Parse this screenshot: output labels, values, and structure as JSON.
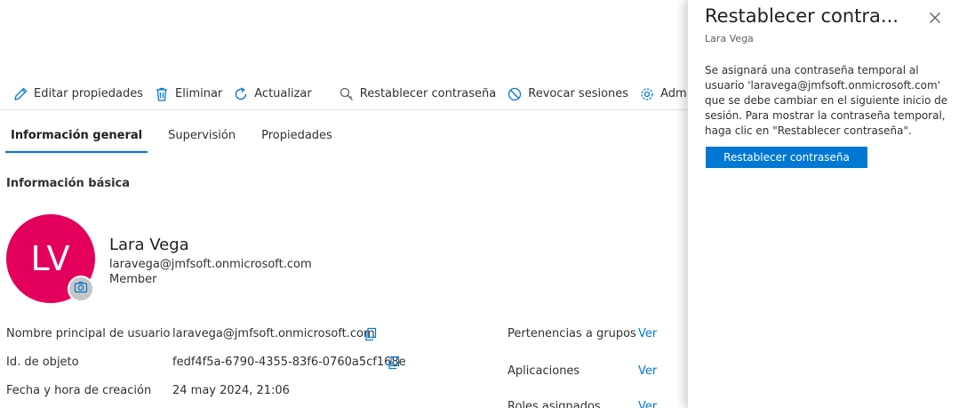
{
  "toolbar": {
    "edit_label": "Editar propiedades",
    "delete_label": "Eliminar",
    "refresh_label": "Actualizar",
    "reset_password_label": "Restablecer contraseña",
    "revoke_sessions_label": "Revocar sesiones",
    "manage_label": "Administrar"
  },
  "tabs": [
    {
      "label": "Información general",
      "active": true
    },
    {
      "label": "Supervisión",
      "active": false
    },
    {
      "label": "Propiedades",
      "active": false
    }
  ],
  "section_title": "Información básica",
  "user": {
    "initials": "LV",
    "avatar_color": "#e3005c",
    "name": "Lara Vega",
    "email": "laravega@jmfsoft.onmicrosoft.com",
    "type": "Member"
  },
  "properties": [
    {
      "label": "Nombre principal de usuario",
      "value": "laravega@jmfsoft.onmicrosoft.com"
    },
    {
      "label": "Id. de objeto",
      "value": "fedf4f5a-6790-4355-83f6-0760a5cf168e"
    },
    {
      "label": "Fecha y hora de creación",
      "value": "24 may 2024, 21:06"
    }
  ],
  "right_properties": [
    {
      "label": "Pertenencias a grupos",
      "link": "Ver"
    },
    {
      "label": "Aplicaciones",
      "link": "Ver"
    },
    {
      "label": "Roles asignados",
      "link": "Ver"
    }
  ],
  "panel": {
    "title": "Restablecer contra...",
    "subtitle": "Lara Vega",
    "description": "Se asignará una contraseña temporal al usuario 'laravega@jmfsoft.onmicrosoft.com' que se debe cambiar en el siguiente inicio de sesión. Para mostrar la contraseña temporal, haga clic en \"Restablecer contraseña\".",
    "button_label": "Restablecer contraseña"
  },
  "colors": {
    "accent": "#0078d4",
    "avatar": "#e3005c"
  }
}
